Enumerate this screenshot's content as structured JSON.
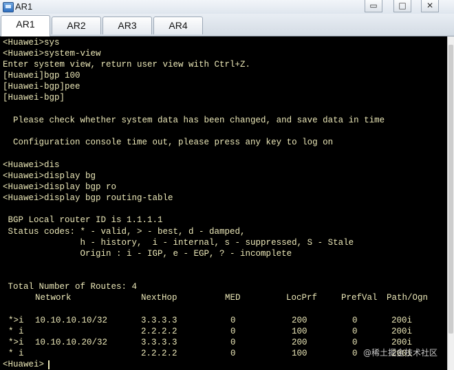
{
  "window": {
    "title": "AR1",
    "minimize_glyph": "▭",
    "maximize_glyph": "□",
    "close_glyph": "✕"
  },
  "tabs": [
    {
      "label": "AR1",
      "active": true
    },
    {
      "label": "AR2",
      "active": false
    },
    {
      "label": "AR3",
      "active": false
    },
    {
      "label": "AR4",
      "active": false
    }
  ],
  "terminal": {
    "lines": [
      "<Huawei>sys",
      "<Huawei>system-view",
      "Enter system view, return user view with Ctrl+Z.",
      "[Huawei]bgp 100",
      "[Huawei-bgp]pee",
      "[Huawei-bgp]",
      "",
      "  Please check whether system data has been changed, and save data in time",
      "",
      "  Configuration console time out, please press any key to log on",
      "",
      "<Huawei>dis",
      "<Huawei>display bg",
      "<Huawei>display bgp ro",
      "<Huawei>display bgp routing-table",
      "",
      " BGP Local router ID is 1.1.1.1",
      " Status codes: * - valid, > - best, d - damped,",
      "               h - history,  i - internal, s - suppressed, S - Stale",
      "               Origin : i - IGP, e - EGP, ? - incomplete",
      "",
      "",
      " Total Number of Routes: 4"
    ],
    "routing_table": {
      "headers": {
        "network": "Network",
        "nexthop": "NextHop",
        "med": "MED",
        "locprf": "LocPrf",
        "prefval": "PrefVal",
        "path": "Path/Ogn"
      },
      "rows": [
        {
          "status": "*>i",
          "network": "10.10.10.10/32",
          "nexthop": "3.3.3.3",
          "med": "0",
          "locprf": "200",
          "prefval": "0",
          "path": "200i"
        },
        {
          "status": "* i",
          "network": "",
          "nexthop": "2.2.2.2",
          "med": "0",
          "locprf": "100",
          "prefval": "0",
          "path": "200i"
        },
        {
          "status": "*>i",
          "network": "10.10.10.20/32",
          "nexthop": "3.3.3.3",
          "med": "0",
          "locprf": "200",
          "prefval": "0",
          "path": "200i"
        },
        {
          "status": "* i",
          "network": "",
          "nexthop": "2.2.2.2",
          "med": "0",
          "locprf": "100",
          "prefval": "0",
          "path": "200i"
        }
      ]
    },
    "prompt": "<Huawei>"
  },
  "watermark": "@稀土掘金技术社区"
}
